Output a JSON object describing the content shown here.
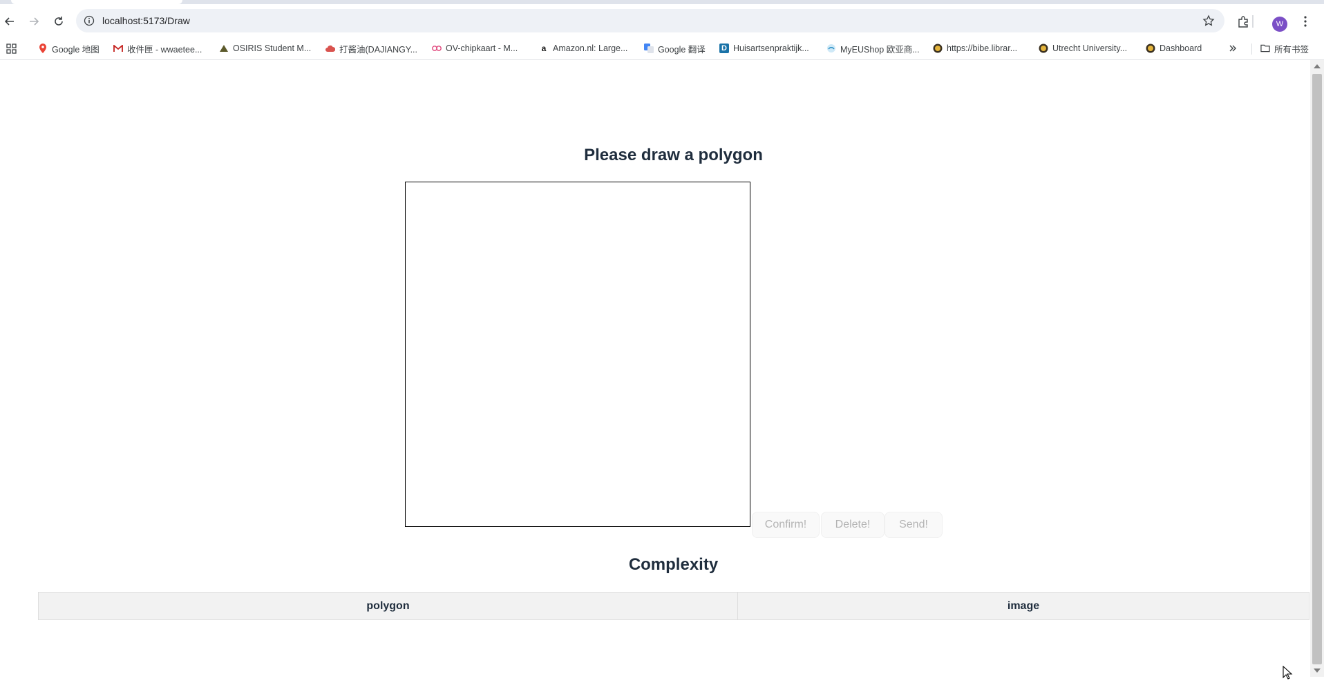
{
  "browser": {
    "url": "localhost:5173/Draw",
    "avatar_letter": "W",
    "bookmarks": [
      {
        "label": "Google 地图",
        "icon": "maps-pin-icon"
      },
      {
        "label": "收件匣 - wwaetee...",
        "icon": "gmail-icon"
      },
      {
        "label": "OSIRIS Student M...",
        "icon": "osiris-icon"
      },
      {
        "label": "打酱油(DAJIANGY...",
        "icon": "cloud-icon"
      },
      {
        "label": "OV-chipkaart - M...",
        "icon": "ov-icon"
      },
      {
        "label": "Amazon.nl: Large...",
        "icon": "amazon-icon"
      },
      {
        "label": "Google 翻译",
        "icon": "translate-icon"
      },
      {
        "label": "Huisartsenpraktijk...",
        "icon": "d-icon"
      },
      {
        "label": "MyEUShop 欧亚商...",
        "icon": "myeushop-icon"
      },
      {
        "label": "https://bibe.librar...",
        "icon": "uu-seal-icon"
      },
      {
        "label": "Utrecht University...",
        "icon": "uu-seal-icon"
      },
      {
        "label": "Dashboard",
        "icon": "uu-seal-icon"
      }
    ],
    "all_bookmarks_label": "所有书签"
  },
  "page": {
    "title": "Please draw a polygon",
    "buttons": {
      "confirm": "Confirm!",
      "delete": "Delete!",
      "send": "Send!"
    },
    "complexity_title": "Complexity",
    "table": {
      "headers": [
        "polygon",
        "image"
      ]
    }
  },
  "colors": {
    "heading_text": "#1f2d3d",
    "button_text_disabled": "#b4b4b4",
    "table_header_bg": "#f2f2f2",
    "avatar_bg": "#7b4fc6"
  }
}
